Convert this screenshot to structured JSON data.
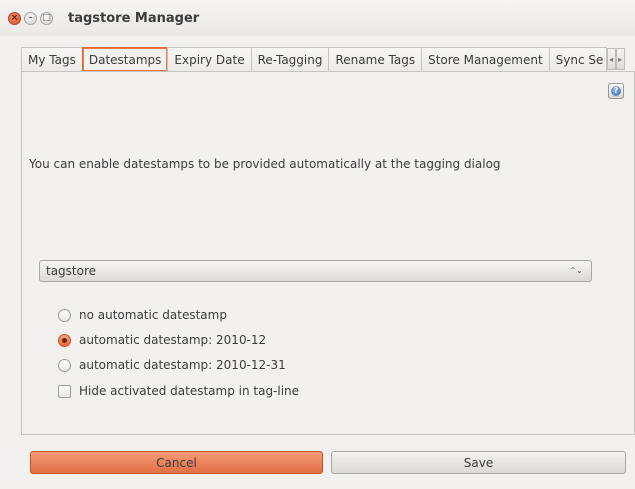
{
  "window": {
    "title": "tagstore Manager",
    "close_glyph": "×",
    "min_glyph": "–",
    "max_glyph": "□"
  },
  "tabs": [
    {
      "label": "My Tags",
      "active": false
    },
    {
      "label": "Datestamps",
      "active": true
    },
    {
      "label": "Expiry Date",
      "active": false
    },
    {
      "label": "Re-Tagging",
      "active": false
    },
    {
      "label": "Rename Tags",
      "active": false
    },
    {
      "label": "Store Management",
      "active": false
    },
    {
      "label": "Sync Se",
      "active": false
    }
  ],
  "tab_scroll": {
    "left": "◂",
    "right": "▸"
  },
  "help": {
    "glyph": "?"
  },
  "description": "You can enable datestamps to be provided automatically at the tagging dialog",
  "store_combo": {
    "selected": "tagstore",
    "arrows": "⌃⌄"
  },
  "options": {
    "none": {
      "label": "no automatic datestamp",
      "checked": false
    },
    "month": {
      "label": "automatic datestamp: 2010-12",
      "checked": true
    },
    "day": {
      "label": "automatic datestamp: 2010-12-31",
      "checked": false
    },
    "hide": {
      "label": "Hide activated datestamp in tag-line",
      "checked": false
    }
  },
  "buttons": {
    "cancel": "Cancel",
    "save": "Save"
  },
  "colors": {
    "accent": "#e36f45",
    "background": "#f2f1f0"
  }
}
